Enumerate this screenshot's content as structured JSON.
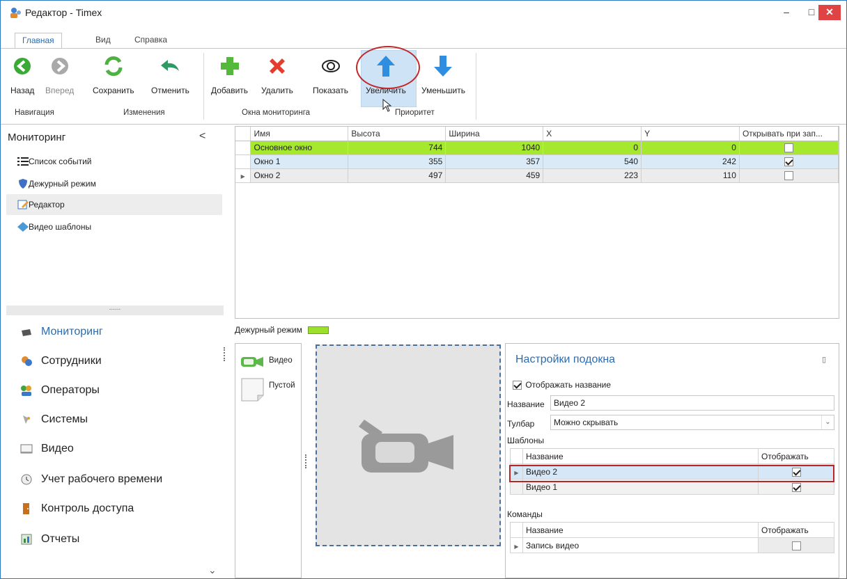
{
  "window": {
    "title": "Редактор - Timex",
    "minimize": "–",
    "maximize": "□",
    "close": "✕"
  },
  "menu_tabs": [
    "Главная",
    "Вид",
    "Справка"
  ],
  "ribbon": {
    "buttons": {
      "back": "Назад",
      "forward": "Вперед",
      "save": "Сохранить",
      "cancel": "Отменить",
      "add": "Добавить",
      "delete": "Удалить",
      "show": "Показать",
      "increase": "Увеличить",
      "decrease": "Уменьшить"
    },
    "groups": {
      "navigation": "Навигация",
      "changes": "Изменения",
      "monitor_windows": "Окна мониторинга",
      "priority": "Приоритет"
    }
  },
  "sidebar": {
    "title": "Мониторинг",
    "collapse": "<",
    "splitter": "......",
    "items": [
      "Список событий",
      "Дежурный режим",
      "Редактор",
      "Видео шаблоны"
    ],
    "sections": [
      "Мониторинг",
      "Сотрудники",
      "Операторы",
      "Системы",
      "Видео",
      "Учет рабочего времени",
      "Контроль доступа",
      "Отчеты"
    ],
    "more": "⌄"
  },
  "grid": {
    "columns": [
      "Имя",
      "Высота",
      "Ширина",
      "X",
      "Y",
      "Открывать при зап..."
    ],
    "rows": [
      {
        "name": "Основное окно",
        "height": "744",
        "width": "1040",
        "x": "0",
        "y": "0",
        "open": false
      },
      {
        "name": "Окно 1",
        "height": "355",
        "width": "357",
        "x": "540",
        "y": "242",
        "open": true
      },
      {
        "name": "Окно 2",
        "height": "497",
        "width": "459",
        "x": "223",
        "y": "110",
        "open": false
      }
    ]
  },
  "legend": {
    "label": "Дежурный режим",
    "color": "#9ce02d"
  },
  "palette": {
    "items": [
      "Видео",
      "Пустой"
    ]
  },
  "settings": {
    "title": "Настройки подокна",
    "show_name_label": "Отображать название",
    "show_name_checked": true,
    "name_label": "Название",
    "name_value": "Видео 2",
    "toolbar_label": "Тулбар",
    "toolbar_value": "Можно скрывать",
    "templates_label": "Шаблоны",
    "templates": {
      "columns": [
        "Название",
        "Отображать"
      ],
      "rows": [
        {
          "name": "Видео 2",
          "show": true
        },
        {
          "name": "Видео 1",
          "show": true
        }
      ]
    },
    "commands_label": "Команды",
    "commands": {
      "columns": [
        "Название",
        "Отображать"
      ],
      "rows": [
        {
          "name": "Запись видео",
          "show": false
        }
      ]
    }
  },
  "colors": {
    "accent": "#2b6cb0",
    "main_row": "#a6e82e",
    "selected_row": "#daebf7",
    "highlight_ring": "#c0282a"
  }
}
